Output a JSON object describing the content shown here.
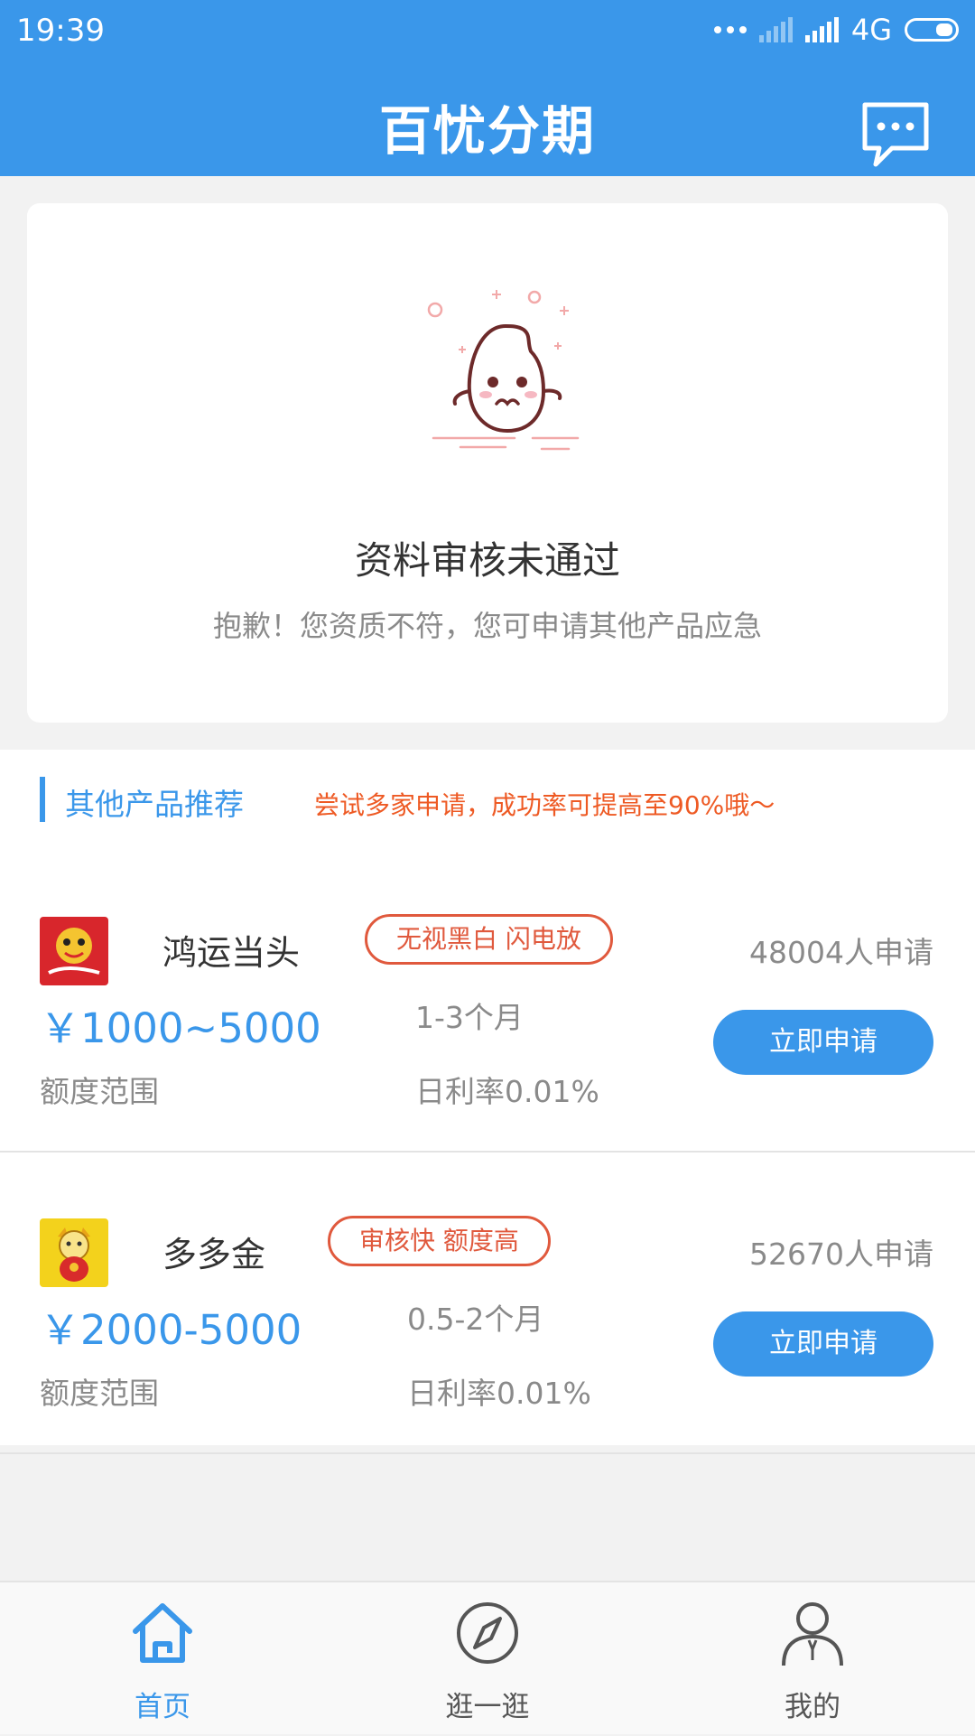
{
  "status_bar": {
    "time": "19:39",
    "network": "4G"
  },
  "header": {
    "title": "百忧分期",
    "message_icon": "chat-bubble-icon"
  },
  "status_card": {
    "title": "资料审核未通过",
    "subtitle": "抱歉！您资质不符，您可申请其他产品应急",
    "illustration": "sad-egg-illustration"
  },
  "recommend": {
    "title": "其他产品推荐",
    "tip": "尝试多家申请，成功率可提高至90%哦～"
  },
  "products": [
    {
      "name": "鸿运当头",
      "tag": "无视黑白 闪电放",
      "applicants": "48004人申请",
      "amount": "￥1000~5000",
      "amount_label": "额度范围",
      "term": "1-3个月",
      "rate": "日利率0.01%",
      "button": "立即申请",
      "logo_icon": "lion-dance-logo-icon"
    },
    {
      "name": "多多金",
      "tag": "审核快 额度高",
      "applicants": "52670人申请",
      "amount": "￥2000-5000",
      "amount_label": "额度范围",
      "term": "0.5-2个月",
      "rate": "日利率0.01%",
      "button": "立即申请",
      "logo_icon": "lucky-cat-logo-icon"
    }
  ],
  "tabbar": [
    {
      "label": "首页",
      "icon": "home-icon",
      "active": true
    },
    {
      "label": "逛一逛",
      "icon": "compass-icon",
      "active": false
    },
    {
      "label": "我的",
      "icon": "user-icon",
      "active": false
    }
  ],
  "colors": {
    "primary": "#3a97ea",
    "accent": "#e0593d",
    "background": "#f2f2f2"
  }
}
